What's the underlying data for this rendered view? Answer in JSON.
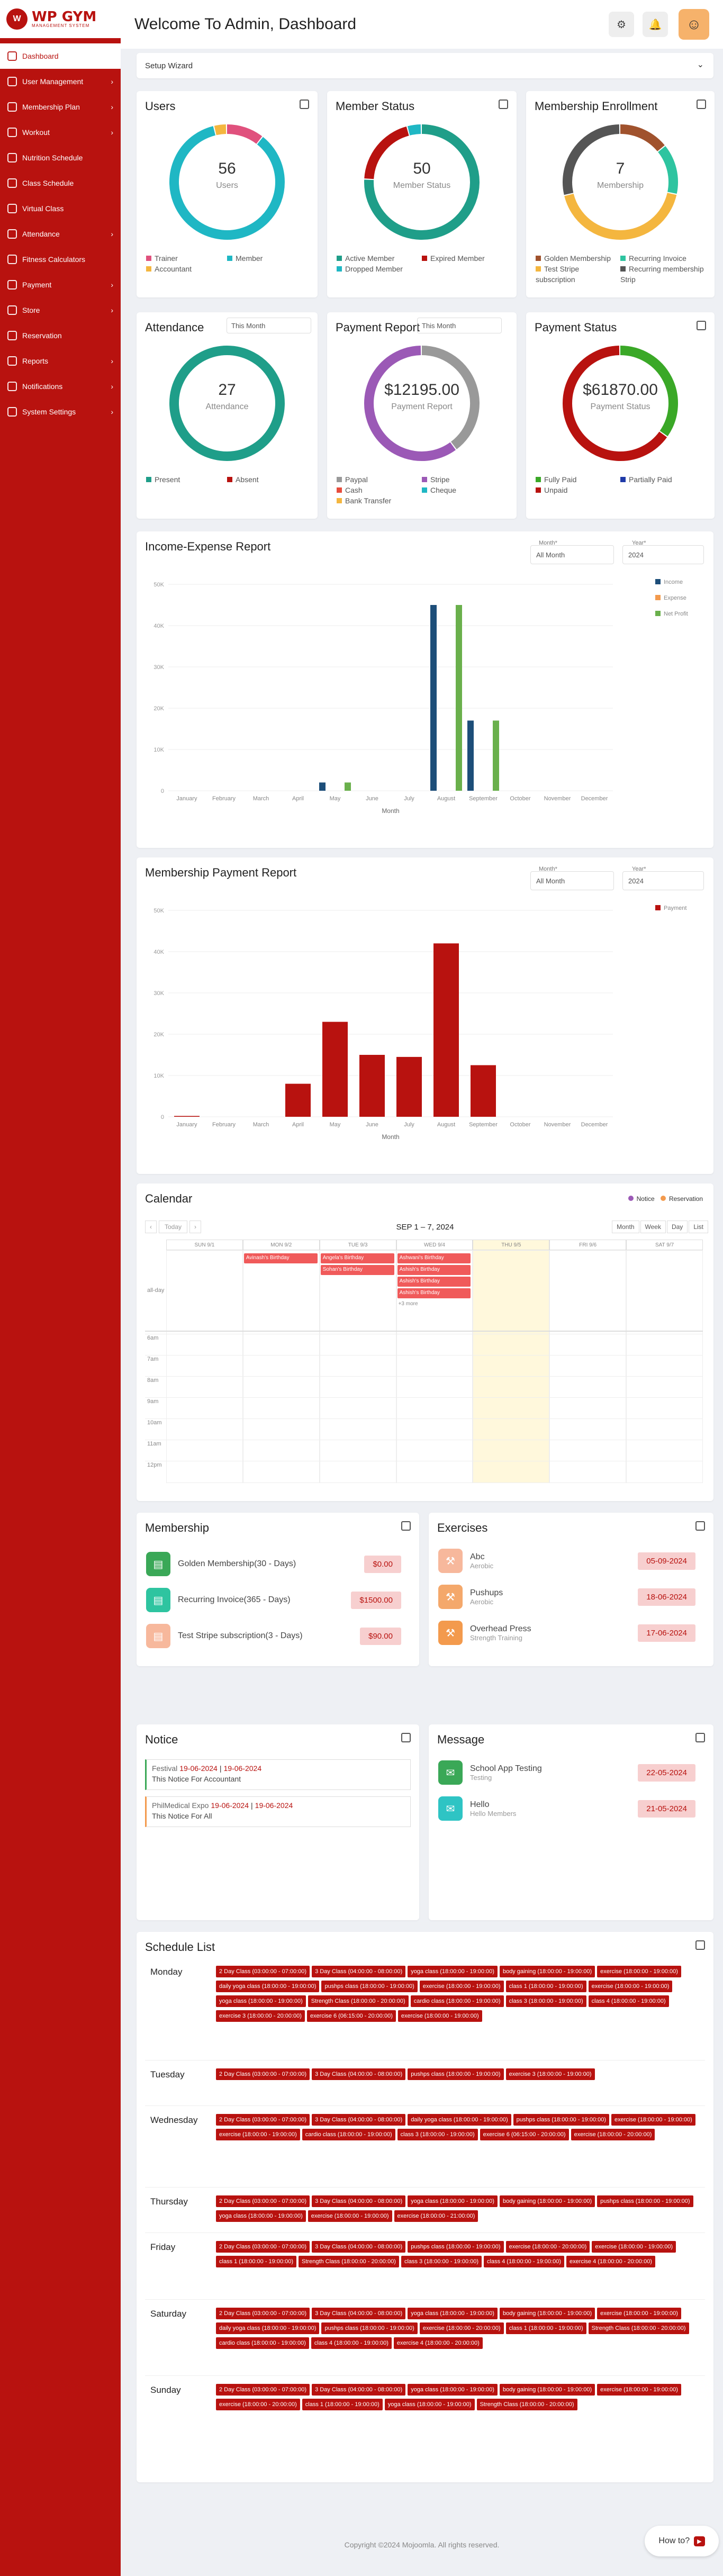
{
  "brand": {
    "name": "WP GYM",
    "sub": "MANAGEMENT SYSTEM"
  },
  "nav": [
    {
      "label": "Dashboard",
      "arrow": false
    },
    {
      "label": "User Management",
      "arrow": true
    },
    {
      "label": "Membership Plan",
      "arrow": true
    },
    {
      "label": "Workout",
      "arrow": true
    },
    {
      "label": "Nutrition Schedule",
      "arrow": false
    },
    {
      "label": "Class Schedule",
      "arrow": false
    },
    {
      "label": "Virtual Class",
      "arrow": false
    },
    {
      "label": "Attendance",
      "arrow": true
    },
    {
      "label": "Fitness Calculators",
      "arrow": false
    },
    {
      "label": "Payment",
      "arrow": true
    },
    {
      "label": "Store",
      "arrow": true
    },
    {
      "label": "Reservation",
      "arrow": false
    },
    {
      "label": "Reports",
      "arrow": true
    },
    {
      "label": "Notifications",
      "arrow": true
    },
    {
      "label": "System Settings",
      "arrow": true
    }
  ],
  "header": {
    "title": "Welcome To Admin, Dashboard"
  },
  "setup": "Setup Wizard",
  "users": {
    "title": "Users",
    "value": "56",
    "label": "Users",
    "legend": [
      "Trainer",
      "Member",
      "Accountant"
    ],
    "colors": [
      "#e0517d",
      "#1fb7c4",
      "#f4b63f"
    ],
    "values": [
      6,
      48,
      2
    ]
  },
  "member_status": {
    "title": "Member Status",
    "value": "50",
    "label": "Member Status",
    "legend": [
      "Active Member",
      "Expired Member",
      "Dropped Member"
    ],
    "colors": [
      "#1f9e89",
      "#b8120f",
      "#1fb7c4"
    ],
    "values": [
      38,
      10,
      2
    ]
  },
  "enrollment": {
    "title": "Membership Enrollment",
    "value": "7",
    "label": "Membership",
    "legend": [
      "Golden Membership",
      "Recurring Invoice",
      "Test Stripe subscription",
      "Recurring membership Strip"
    ],
    "colors": [
      "#a0522d",
      "#2ec4a0",
      "#f4b63f",
      "#555"
    ],
    "values": [
      1,
      1,
      3,
      2
    ]
  },
  "attendance": {
    "title": "Attendance",
    "filter": "This Month",
    "value": "27",
    "label": "Attendance",
    "legend": [
      "Present",
      "Absent"
    ],
    "colors": [
      "#1f9e89",
      "#b8120f"
    ],
    "values": [
      27,
      0
    ]
  },
  "payment_report": {
    "title": "Payment Report",
    "filter": "This Month",
    "value": "$12195.00",
    "label": "Payment Report",
    "legend": [
      "Paypal",
      "Stripe",
      "Cash",
      "Cheque",
      "Bank Transfer"
    ],
    "colors": [
      "#999",
      "#9b59b6",
      "#e74c3c",
      "#1fb7c4",
      "#f4b63f"
    ],
    "values": [
      4,
      6,
      0,
      0,
      0
    ]
  },
  "payment_status": {
    "title": "Payment Status",
    "value": "$61870.00",
    "label": "Payment Status",
    "legend": [
      "Fully Paid",
      "Partially Paid",
      "Unpaid"
    ],
    "colors": [
      "#3aa827",
      "#1f3aa8",
      "#b8120f"
    ],
    "values": [
      35,
      0,
      65
    ]
  },
  "income_report": {
    "title": "Income-Expense Report",
    "month_label": "Month*",
    "month": "All Month",
    "year_label": "Year*",
    "year": "2024"
  },
  "membership_report": {
    "title": "Membership Payment Report",
    "month_label": "Month*",
    "month": "All Month",
    "year_label": "Year*",
    "year": "2024"
  },
  "chart_data": [
    {
      "type": "bar",
      "xlabel": "Month",
      "categories": [
        "January",
        "February",
        "March",
        "April",
        "May",
        "June",
        "July",
        "August",
        "September",
        "October",
        "November",
        "December"
      ],
      "ylim": [
        0,
        50000
      ],
      "ticks": [
        "0",
        "10K",
        "20K",
        "30K",
        "40K",
        "50K"
      ],
      "series": [
        {
          "name": "Income",
          "color": "#1d4e79",
          "values": [
            0,
            0,
            0,
            0,
            2000,
            0,
            0,
            45000,
            17000,
            0,
            0,
            0
          ]
        },
        {
          "name": "Expense",
          "color": "#f39a4d",
          "values": [
            0,
            0,
            0,
            0,
            0,
            0,
            0,
            0,
            0,
            0,
            0,
            0
          ]
        },
        {
          "name": "Net Profit",
          "color": "#6ab04c",
          "values": [
            0,
            0,
            0,
            0,
            2000,
            0,
            0,
            45000,
            17000,
            0,
            0,
            0
          ]
        }
      ]
    },
    {
      "type": "bar",
      "xlabel": "Month",
      "categories": [
        "January",
        "February",
        "March",
        "April",
        "May",
        "June",
        "July",
        "August",
        "September",
        "October",
        "November",
        "December"
      ],
      "ylim": [
        0,
        50000
      ],
      "ticks": [
        "0",
        "10K",
        "20K",
        "30K",
        "40K",
        "50K"
      ],
      "series": [
        {
          "name": "Payment",
          "color": "#b8120f",
          "values": [
            200,
            0,
            0,
            8000,
            23000,
            15000,
            14500,
            42000,
            12500,
            0,
            0,
            0
          ]
        }
      ]
    }
  ],
  "calendar": {
    "title": "Calendar",
    "legend": [
      "Notice",
      "Reservation"
    ],
    "range": "SEP 1 – 7, 2024",
    "today": "Today",
    "views": [
      "Month",
      "Week",
      "Day",
      "List"
    ],
    "days": [
      "SUN 9/1",
      "MON 9/2",
      "TUE 9/3",
      "WED 9/4",
      "THU 9/5",
      "FRI 9/6",
      "SAT 9/7"
    ],
    "times": [
      "6am",
      "7am",
      "8am",
      "9am",
      "10am",
      "11am",
      "12pm"
    ],
    "allday": "all-day",
    "events": [
      {
        "day": 1,
        "text": "Avinash's Birthday"
      },
      {
        "day": 2,
        "text": "Angela's Birthday"
      },
      {
        "day": 2,
        "text": "Sohan's Birthday"
      },
      {
        "day": 3,
        "text": "Ashwani's Birthday"
      },
      {
        "day": 3,
        "text": "Ashish's Birthday"
      },
      {
        "day": 3,
        "text": "Ashish's Birthday"
      },
      {
        "day": 3,
        "text": "Ashish's Birthday"
      }
    ],
    "more": "+3 more"
  },
  "membership": {
    "title": "Membership",
    "items": [
      {
        "name": "Golden Membership(30 - Days)",
        "price": "$0.00",
        "color": "#3aa857"
      },
      {
        "name": "Recurring Invoice(365 - Days)",
        "price": "$1500.00",
        "color": "#2ec4a0"
      },
      {
        "name": "Test Stripe subscription(3 - Days)",
        "price": "$90.00",
        "color": "#f7b89c"
      }
    ]
  },
  "exercises": {
    "title": "Exercises",
    "items": [
      {
        "name": "Abc",
        "sub": "Aerobic",
        "date": "05-09-2024",
        "color": "#f7b89c"
      },
      {
        "name": "Pushups",
        "sub": "Aerobic",
        "date": "18-06-2024",
        "color": "#f4a86b"
      },
      {
        "name": "Overhead Press",
        "sub": "Strength Training",
        "date": "17-06-2024",
        "color": "#f39a4d"
      }
    ]
  },
  "notice": {
    "title": "Notice",
    "items": [
      {
        "name": "Festival",
        "d1": "19-06-2024",
        "d2": "19-06-2024",
        "desc": "This Notice For Accountant",
        "color": "#3aa857"
      },
      {
        "name": "PhilMedical Expo",
        "d1": "19-06-2024",
        "d2": "19-06-2024",
        "desc": "This Notice For All",
        "color": "#f39a4d"
      }
    ]
  },
  "message": {
    "title": "Message",
    "items": [
      {
        "name": "School App Testing",
        "sub": "Testing",
        "date": "22-05-2024"
      },
      {
        "name": "Hello",
        "sub": "Hello Members",
        "date": "21-05-2024"
      }
    ]
  },
  "schedule": {
    "title": "Schedule List",
    "days": [
      {
        "day": "Monday",
        "tags": [
          "2 Day Class (03:00:00 - 07:00:00)",
          "3 Day Class (04:00:00 - 08:00:00)",
          "yoga class (18:00:00 - 19:00:00)",
          "body gaining (18:00:00 - 19:00:00)",
          "exercise (18:00:00 - 19:00:00)",
          "daily yoga class (18:00:00 - 19:00:00)",
          "pushps class (18:00:00 - 19:00:00)",
          "exercise (18:00:00 - 19:00:00)",
          "class 1 (18:00:00 - 19:00:00)",
          "exercise (18:00:00 - 19:00:00)",
          "yoga class (18:00:00 - 19:00:00)",
          "Strength Class (18:00:00 - 20:00:00)",
          "cardio class (18:00:00 - 19:00:00)",
          "class 3 (18:00:00 - 19:00:00)",
          "class 4 (18:00:00 - 19:00:00)",
          "exercise 3 (18:00:00 - 20:00:00)",
          "exercise 6 (06:15:00 - 20:00:00)",
          "exercise (18:00:00 - 19:00:00)"
        ]
      },
      {
        "day": "Tuesday",
        "tags": [
          "2 Day Class (03:00:00 - 07:00:00)",
          "3 Day Class (04:00:00 - 08:00:00)",
          "pushps class (18:00:00 - 19:00:00)",
          "exercise 3 (18:00:00 - 19:00:00)"
        ]
      },
      {
        "day": "Wednesday",
        "tags": [
          "2 Day Class (03:00:00 - 07:00:00)",
          "3 Day Class (04:00:00 - 08:00:00)",
          "daily yoga class (18:00:00 - 19:00:00)",
          "pushps class (18:00:00 - 19:00:00)",
          "exercise (18:00:00 - 19:00:00)",
          "exercise (18:00:00 - 19:00:00)",
          "cardio class (18:00:00 - 19:00:00)",
          "class 3 (18:00:00 - 19:00:00)",
          "exercise 6 (06:15:00 - 20:00:00)",
          "exercise (18:00:00 - 20:00:00)"
        ]
      },
      {
        "day": "Thursday",
        "tags": [
          "2 Day Class (03:00:00 - 07:00:00)",
          "3 Day Class (04:00:00 - 08:00:00)",
          "yoga class (18:00:00 - 19:00:00)",
          "body gaining (18:00:00 - 19:00:00)",
          "pushps class (18:00:00 - 19:00:00)",
          "yoga class (18:00:00 - 19:00:00)",
          "exercise (18:00:00 - 19:00:00)",
          "exercise (18:00:00 - 21:00:00)"
        ]
      },
      {
        "day": "Friday",
        "tags": [
          "2 Day Class (03:00:00 - 07:00:00)",
          "3 Day Class (04:00:00 - 08:00:00)",
          "pushps class (18:00:00 - 19:00:00)",
          "exercise (18:00:00 - 20:00:00)",
          "exercise (18:00:00 - 19:00:00)",
          "class 1 (18:00:00 - 19:00:00)",
          "Strength Class (18:00:00 - 20:00:00)",
          "class 3 (18:00:00 - 19:00:00)",
          "class 4 (18:00:00 - 19:00:00)",
          "exercise 4 (18:00:00 - 20:00:00)"
        ]
      },
      {
        "day": "Saturday",
        "tags": [
          "2 Day Class (03:00:00 - 07:00:00)",
          "3 Day Class (04:00:00 - 08:00:00)",
          "yoga class (18:00:00 - 19:00:00)",
          "body gaining (18:00:00 - 19:00:00)",
          "exercise (18:00:00 - 19:00:00)",
          "daily yoga class (18:00:00 - 19:00:00)",
          "pushps class (18:00:00 - 19:00:00)",
          "exercise (18:00:00 - 20:00:00)",
          "class 1 (18:00:00 - 19:00:00)",
          "Strength Class (18:00:00 - 20:00:00)",
          "cardio class (18:00:00 - 19:00:00)",
          "class 4 (18:00:00 - 19:00:00)",
          "exercise 4 (18:00:00 - 20:00:00)"
        ]
      },
      {
        "day": "Sunday",
        "tags": [
          "2 Day Class (03:00:00 - 07:00:00)",
          "3 Day Class (04:00:00 - 08:00:00)",
          "yoga class (18:00:00 - 19:00:00)",
          "body gaining (18:00:00 - 19:00:00)",
          "exercise (18:00:00 - 19:00:00)",
          "exercise (18:00:00 - 20:00:00)",
          "class 1 (18:00:00 - 19:00:00)",
          "yoga class (18:00:00 - 19:00:00)",
          "Strength Class (18:00:00 - 20:00:00)"
        ]
      }
    ]
  },
  "footer": {
    "text": "Copyright ©2024 Mojoomla. All rights reserved."
  },
  "help": "How to?"
}
